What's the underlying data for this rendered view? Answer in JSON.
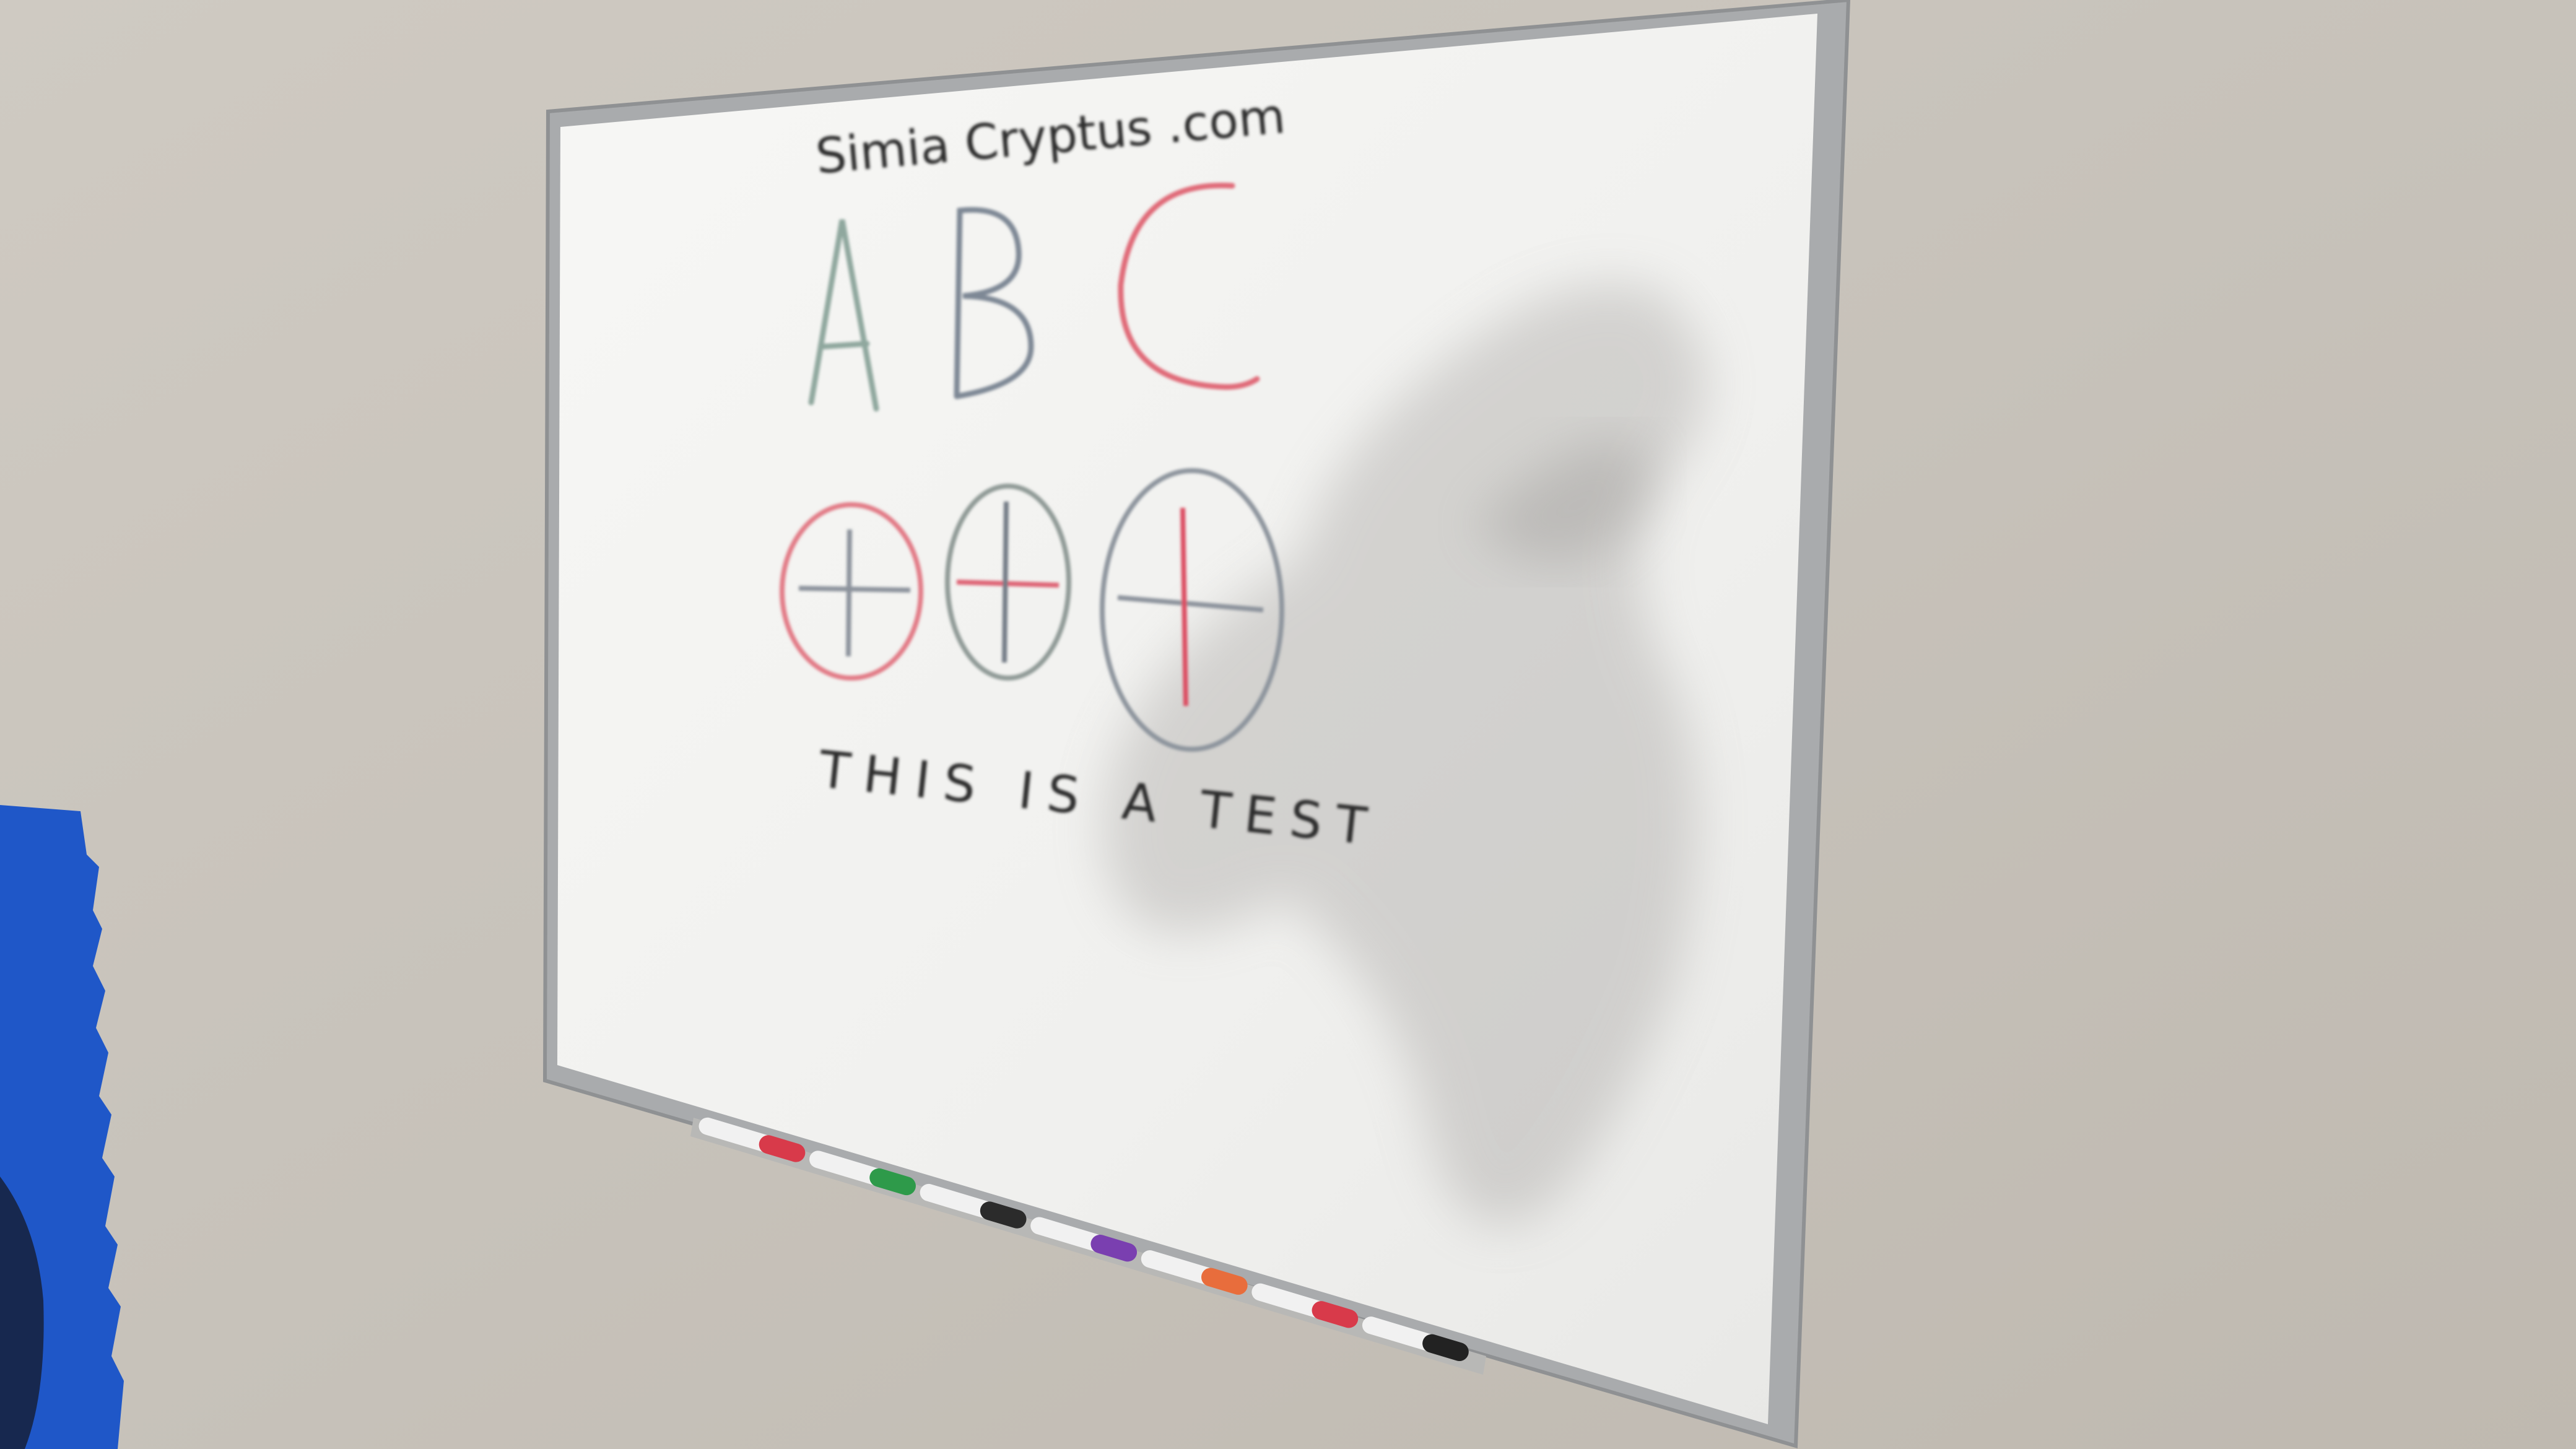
{
  "scene": {
    "wall_color": "#c9c4bc",
    "board_color": "#f4f4f2",
    "frame_color": "#a9abad",
    "shadow_color": "#9c9996",
    "foam_color": "#1f57c8"
  },
  "whiteboard": {
    "header_text": "Simia Cryptus .com",
    "letters": [
      {
        "char": "A",
        "color": "#8fa79e"
      },
      {
        "char": "B",
        "color": "#7e8895"
      },
      {
        "char": "C",
        "color": "#e06a78"
      }
    ],
    "circles": [
      {
        "ring_color": "#e27a86",
        "h_color": "#8c939c",
        "v_color": "#8c939c"
      },
      {
        "ring_color": "#8f9a96",
        "h_color": "#de6474",
        "v_color": "#737b86"
      },
      {
        "ring_color": "#8d949d",
        "h_color": "#8c939c",
        "v_color": "#dc4e62"
      }
    ],
    "footer_text": "THIS IS A TEST"
  },
  "markers": [
    {
      "color": "#d83a4a"
    },
    {
      "color": "#2e9a4a"
    },
    {
      "color": "#2b2b2b"
    },
    {
      "color": "#7a3fb0"
    },
    {
      "color": "#e86d3c"
    },
    {
      "color": "#d83a4a"
    },
    {
      "color": "#222222"
    }
  ]
}
